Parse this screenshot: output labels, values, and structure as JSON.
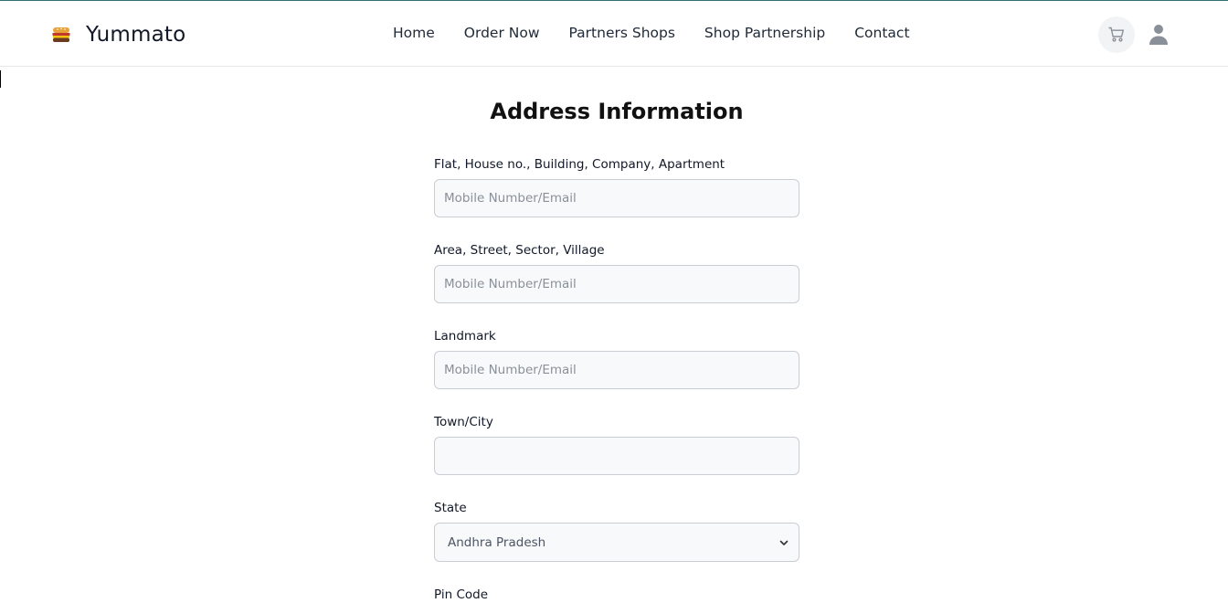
{
  "header": {
    "brand_name": "Yummato",
    "brand_logo": "burger-logo",
    "nav": [
      "Home",
      "Order Now",
      "Partners Shops",
      "Shop Partnership",
      "Contact"
    ],
    "cart_icon": "cart-icon",
    "user_icon": "user-icon"
  },
  "form": {
    "title": "Address Information",
    "fields": [
      {
        "label": "Flat, House no., Building, Company, Apartment",
        "placeholder": "Mobile Number/Email",
        "value": ""
      },
      {
        "label": "Area, Street, Sector, Village",
        "placeholder": "Mobile Number/Email",
        "value": ""
      },
      {
        "label": "Landmark",
        "placeholder": "Mobile Number/Email",
        "value": ""
      },
      {
        "label": "Town/City",
        "placeholder": "",
        "value": ""
      }
    ],
    "state": {
      "label": "State",
      "selected": "Andhra Pradesh"
    },
    "pincode": {
      "label": "Pin Code"
    }
  },
  "colors": {
    "accent_line": "#2f6f75",
    "input_bg": "#f8f9fa",
    "input_border": "#c9cdd4"
  }
}
